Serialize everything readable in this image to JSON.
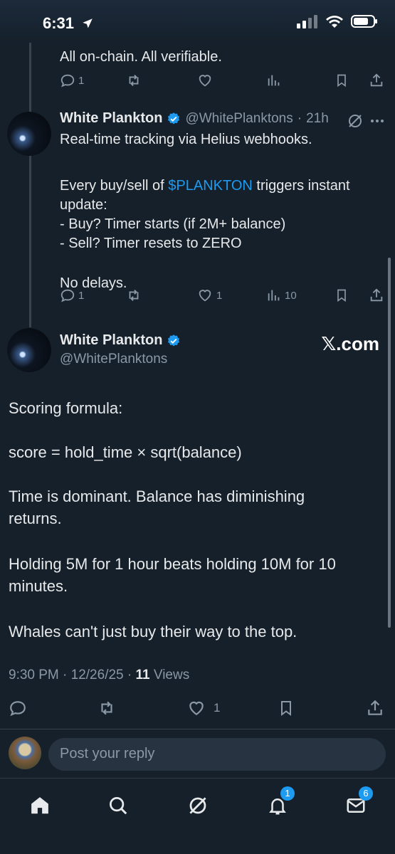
{
  "status": {
    "time": "6:31"
  },
  "thread": {
    "prev_tail": {
      "text": "All on-chain. All verifiable.",
      "reply_count": "1",
      "repost_count": "",
      "like_count": "",
      "view_count": ""
    },
    "tweet2": {
      "name": "White Plankton",
      "handle": "@WhitePlanktons",
      "time": "21h",
      "line1": "Real-time tracking via Helius webhooks.",
      "line2_pre": "Every buy/sell of ",
      "line2_tag": "$PLANKTON",
      "line2_post": " triggers instant",
      "line3": "update:",
      "line4": "- Buy? Timer starts (if 2M+ balance)",
      "line5": "- Sell? Timer resets to ZERO",
      "line6": "No delays.",
      "reply_count": "1",
      "like_count": "1",
      "view_count": "10"
    },
    "main": {
      "name": "White Plankton",
      "handle": "@WhitePlanktons",
      "watermark": "𝕏.com",
      "p1": "Scoring formula:",
      "p2": "score = hold_time × sqrt(balance)",
      "p3a": "Time is dominant. Balance has diminishing",
      "p3b": "returns.",
      "p4a": "Holding 5M for 1 hour beats holding 10M for 10",
      "p4b": "minutes.",
      "p5": "Whales can't just buy their way to the top.",
      "timestamp": "9:30 PM · 12/26/25 · ",
      "views_count": "11",
      "views_label": " Views",
      "like_count": "1"
    }
  },
  "reply": {
    "placeholder": "Post your reply"
  },
  "nav": {
    "notifications_badge": "1",
    "messages_badge": "6"
  },
  "colors": {
    "background": "#15202b",
    "accent": "#1d9bf0",
    "muted": "#8b98a5"
  }
}
